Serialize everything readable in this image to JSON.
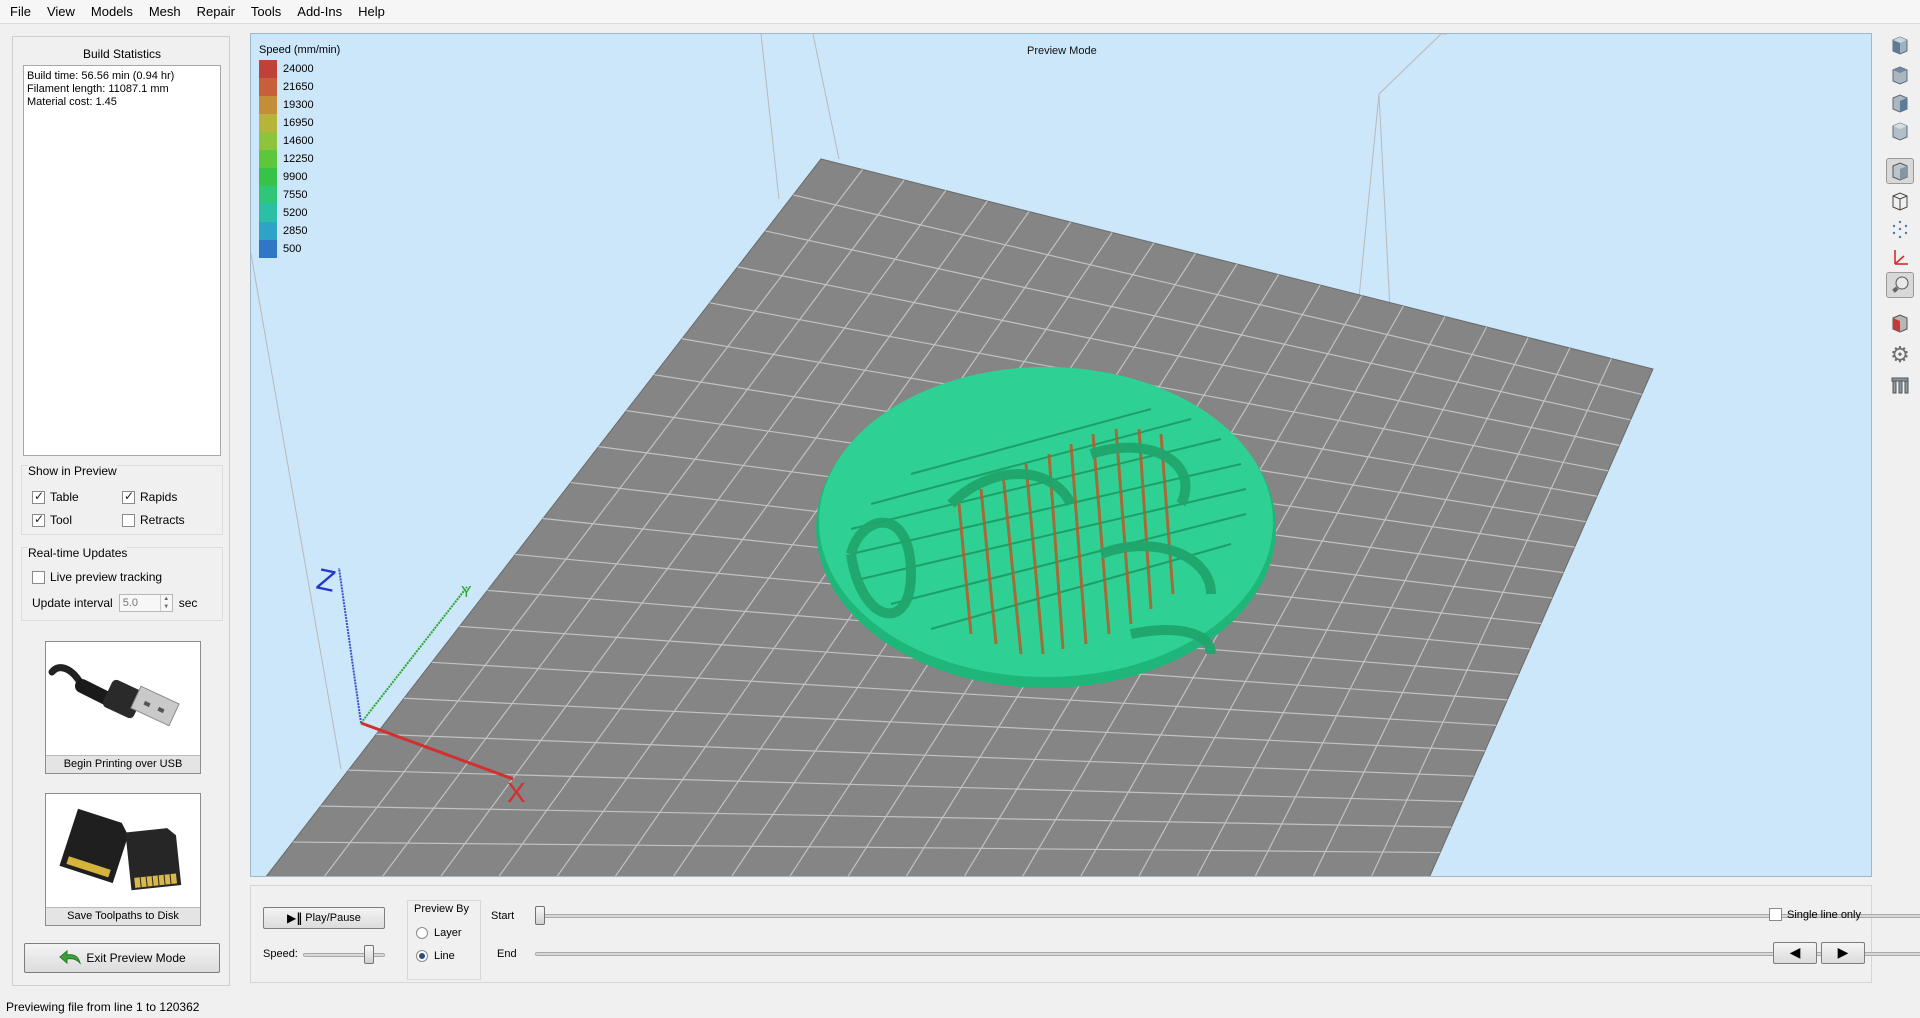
{
  "menu": [
    "File",
    "View",
    "Models",
    "Mesh",
    "Repair",
    "Tools",
    "Add-Ins",
    "Help"
  ],
  "build_stats": {
    "title": "Build Statistics",
    "lines": [
      "Build time: 56.56 min (0.94 hr)",
      "Filament length: 11087.1 mm",
      "Material cost: 1.45"
    ]
  },
  "show_in_preview": {
    "title": "Show in Preview",
    "items": [
      {
        "label": "Table",
        "checked": true
      },
      {
        "label": "Rapids",
        "checked": true
      },
      {
        "label": "Tool",
        "checked": true
      },
      {
        "label": "Retracts",
        "checked": false
      }
    ]
  },
  "realtime": {
    "title": "Real-time Updates",
    "live_label": "Live preview tracking",
    "live_checked": false,
    "interval_label": "Update interval",
    "interval_value": "5.0",
    "interval_unit": "sec"
  },
  "actions": {
    "usb_label": "Begin Printing over USB",
    "sd_label": "Save Toolpaths to Disk",
    "exit_label": "Exit Preview Mode"
  },
  "viewport": {
    "mode_label": "Preview Mode",
    "axis_x": "X",
    "axis_y": "Y",
    "axis_z": "Z"
  },
  "legend": {
    "title": "Speed (mm/min)",
    "entries": [
      {
        "label": "24000",
        "color": "#c0403a"
      },
      {
        "label": "21650",
        "color": "#c5603a"
      },
      {
        "label": "19300",
        "color": "#c48d3a"
      },
      {
        "label": "16950",
        "color": "#b6b53a"
      },
      {
        "label": "14600",
        "color": "#8ec43b"
      },
      {
        "label": "12250",
        "color": "#5cc63c"
      },
      {
        "label": "9900",
        "color": "#38c24a"
      },
      {
        "label": "7550",
        "color": "#2fc67a"
      },
      {
        "label": "5200",
        "color": "#2bc0a5"
      },
      {
        "label": "2850",
        "color": "#2ea3c6"
      },
      {
        "label": "500",
        "color": "#2f76c4"
      }
    ]
  },
  "right_toolbar": [
    {
      "name": "view-front-icon"
    },
    {
      "name": "view-top-icon"
    },
    {
      "name": "view-side-icon"
    },
    {
      "name": "view-iso-icon"
    },
    {
      "name": "solid-view-icon",
      "active": true
    },
    {
      "name": "wireframe-view-icon"
    },
    {
      "name": "points-view-icon"
    },
    {
      "name": "axes-toggle-icon"
    },
    {
      "name": "lightbulb-icon",
      "active": true
    },
    {
      "name": "section-view-icon"
    },
    {
      "name": "gear-icon"
    },
    {
      "name": "supports-icon"
    }
  ],
  "playback": {
    "play_label": "Play/Pause",
    "speed_label": "Speed:",
    "speed_value": 0.85,
    "preview_by_title": "Preview By",
    "layer_label": "Layer",
    "line_label": "Line",
    "selected": "Line",
    "start_label": "Start",
    "end_label": "End",
    "start_value": 0,
    "end_value": 1,
    "single_line_label": "Single line only",
    "single_line_checked": false
  },
  "status": "Previewing file from line 1 to 120362"
}
